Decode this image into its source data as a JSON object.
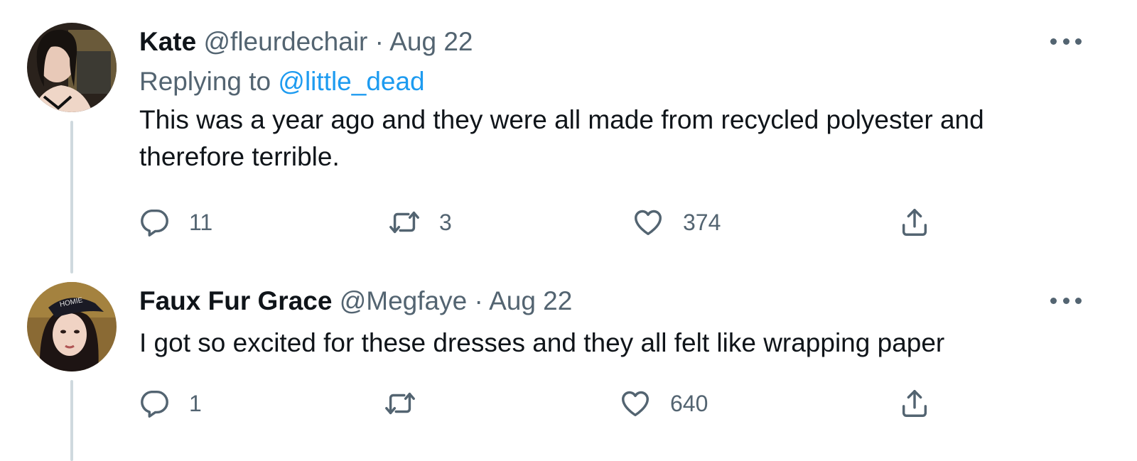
{
  "tweets": [
    {
      "name": "Kate",
      "handle": "@fleurdechair",
      "separator": "·",
      "date": "Aug 22",
      "replying_prefix": "Replying to",
      "replying_to": "@little_dead",
      "text_line1": "This was a year ago and they were all made from recycled polyester and",
      "text_line2": "therefore terrible.",
      "reply_count": "11",
      "retweet_count": "3",
      "like_count": "374",
      "icons": [
        "reply-icon",
        "retweet-icon",
        "like-icon",
        "share-icon",
        "more-icon"
      ]
    },
    {
      "name": "Faux Fur Grace",
      "handle": "@Megfaye",
      "separator": "·",
      "date": "Aug 22",
      "text": "I got so excited for these dresses and they all felt like wrapping paper",
      "reply_count": "1",
      "retweet_count": "",
      "like_count": "640",
      "icons": [
        "reply-icon",
        "retweet-icon",
        "like-icon",
        "share-icon",
        "more-icon"
      ]
    }
  ],
  "colors": {
    "text": "#0f1419",
    "secondary": "#536471",
    "link": "#1d9bf0",
    "thread_line": "#cfd9de"
  }
}
